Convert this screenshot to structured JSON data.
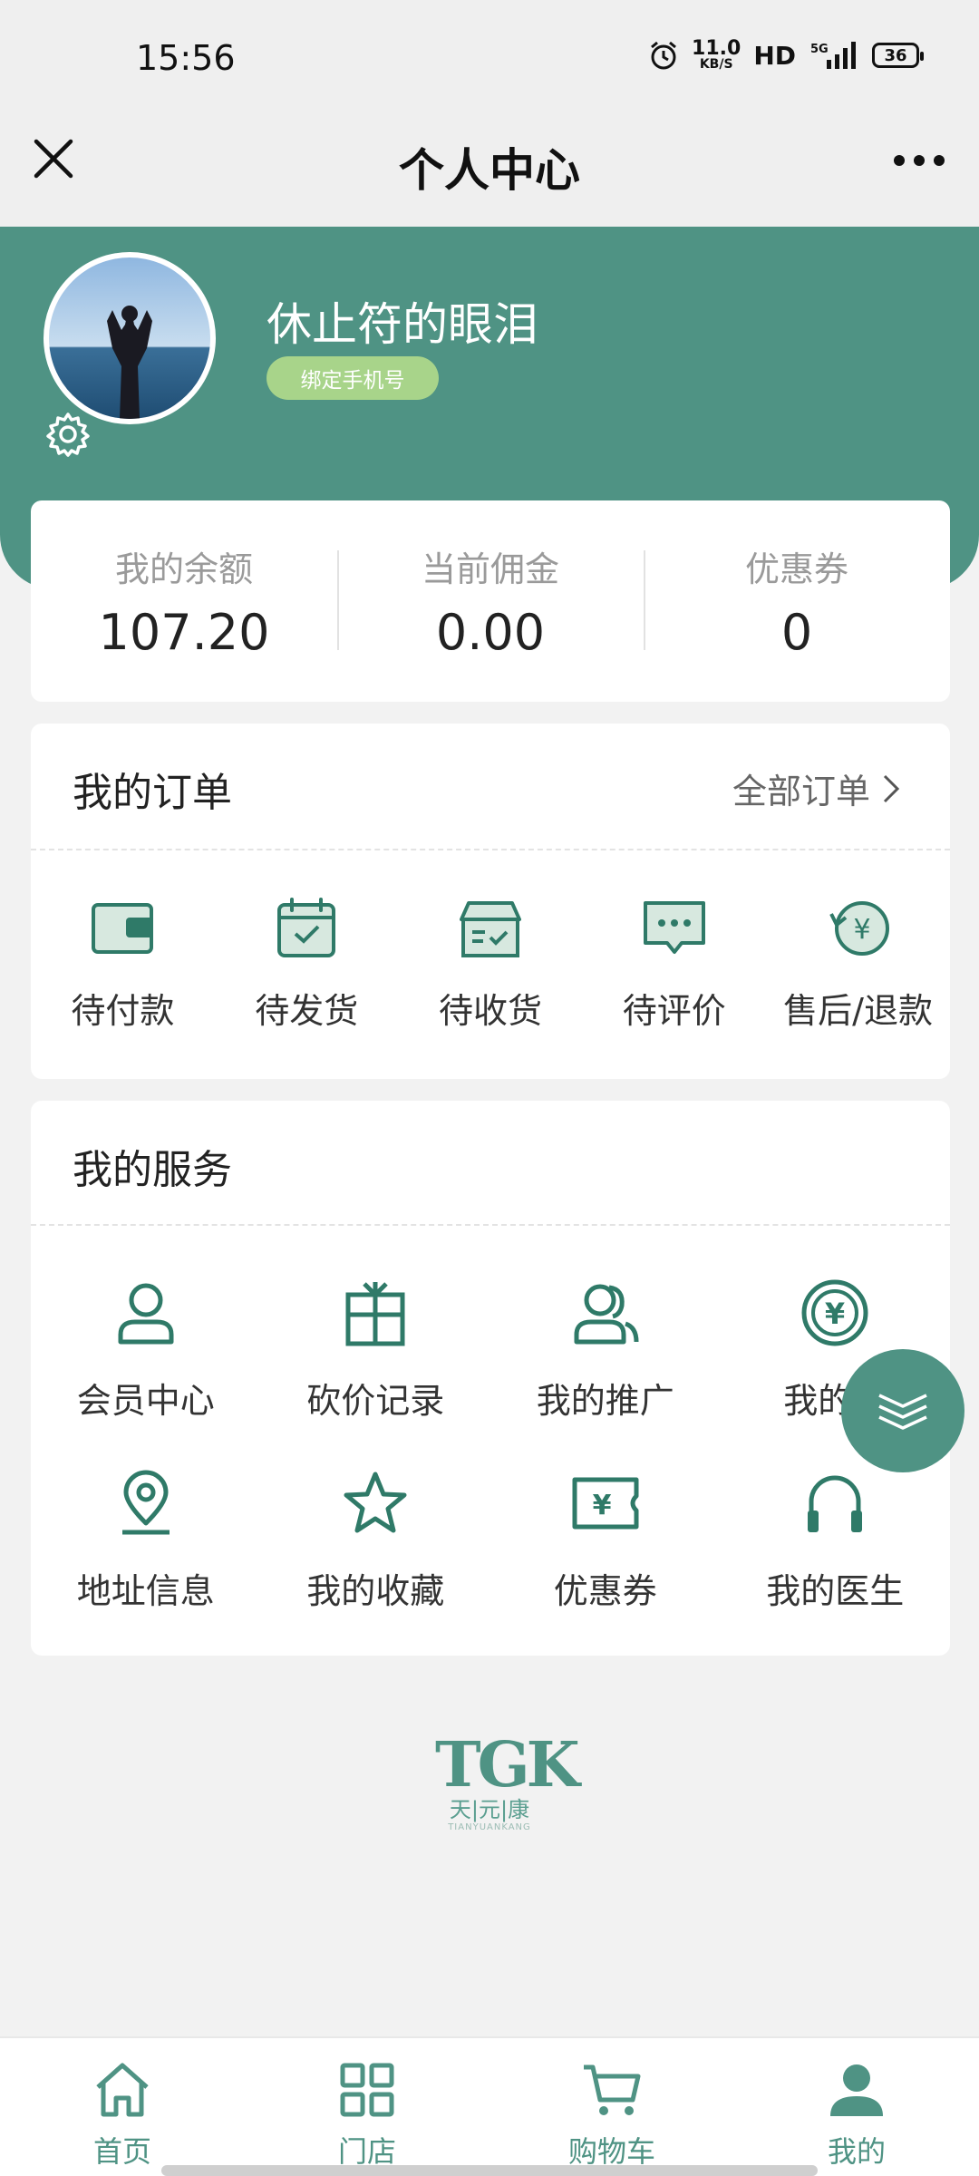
{
  "status_bar": {
    "time": "15:56",
    "net_speed": "11.0",
    "net_unit": "KB/S",
    "hd": "HD",
    "network": "5G",
    "battery": "36"
  },
  "nav": {
    "title": "个人中心",
    "close_icon": "close-icon",
    "more_icon": "more-dots-icon"
  },
  "profile": {
    "username": "休止符的眼泪",
    "bind_phone_label": "绑定手机号"
  },
  "stats": [
    {
      "label": "我的余额",
      "value": "107.20"
    },
    {
      "label": "当前佣金",
      "value": "0.00"
    },
    {
      "label": "优惠券",
      "value": "0"
    }
  ],
  "orders": {
    "title": "我的订单",
    "all_label": "全部订单",
    "items": [
      {
        "label": "待付款",
        "icon": "wallet-icon"
      },
      {
        "label": "待发货",
        "icon": "calendar-check-icon"
      },
      {
        "label": "待收货",
        "icon": "box-icon"
      },
      {
        "label": "待评价",
        "icon": "comment-icon"
      },
      {
        "label": "售后/退款",
        "icon": "refund-icon"
      }
    ]
  },
  "services": {
    "title": "我的服务",
    "items": [
      {
        "label": "会员中心",
        "icon": "user-icon"
      },
      {
        "label": "砍价记录",
        "icon": "gift-icon"
      },
      {
        "label": "我的推广",
        "icon": "users-icon"
      },
      {
        "label": "我的金",
        "icon": "yen-coin-icon"
      },
      {
        "label": "地址信息",
        "icon": "location-icon"
      },
      {
        "label": "我的收藏",
        "icon": "star-icon"
      },
      {
        "label": "优惠券",
        "icon": "ticket-icon"
      },
      {
        "label": "我的医生",
        "icon": "headphone-icon"
      }
    ]
  },
  "logo": {
    "main": "TGK",
    "cn": "天|元|康",
    "en": "TIANYUANKANG"
  },
  "tabbar": [
    {
      "label": "首页",
      "icon": "home-icon"
    },
    {
      "label": "门店",
      "icon": "grid-icon"
    },
    {
      "label": "购物车",
      "icon": "cart-icon"
    },
    {
      "label": "我的",
      "icon": "profile-icon"
    }
  ],
  "colors": {
    "primary": "#4f9384",
    "bind_button": "#a8d48a",
    "background": "#f2f2f2"
  }
}
